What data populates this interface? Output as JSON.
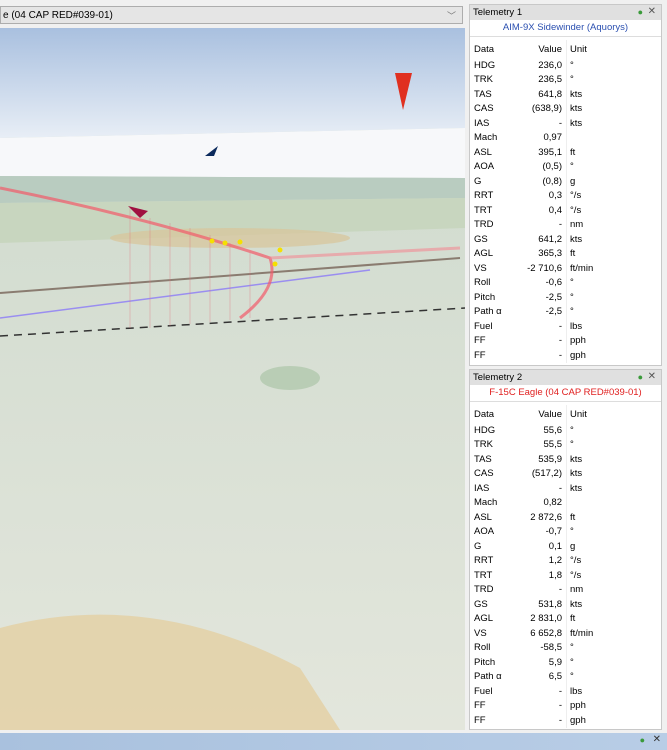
{
  "selector": {
    "value": "e (04 CAP RED#039-01)"
  },
  "panels": [
    {
      "title": "Telemetry 1",
      "subject": "AIM-9X Sidewinder (Aquorys)",
      "subject_color": "#2a4fb0",
      "headers": [
        "Data",
        "Value",
        "Unit"
      ],
      "rows": [
        [
          "HDG",
          "236,0",
          "°"
        ],
        [
          "TRK",
          "236,5",
          "°"
        ],
        [
          "TAS",
          "641,8",
          "kts"
        ],
        [
          "CAS",
          "(638,9)",
          "kts"
        ],
        [
          "IAS",
          "-",
          "kts"
        ],
        [
          "Mach",
          "0,97",
          ""
        ],
        [
          "ASL",
          "395,1",
          "ft"
        ],
        [
          "AOA",
          "(0,5)",
          "°"
        ],
        [
          "G",
          "(0,8)",
          "g"
        ],
        [
          "RRT",
          "0,3",
          "°/s"
        ],
        [
          "TRT",
          "0,4",
          "°/s"
        ],
        [
          "TRD",
          "-",
          "nm"
        ],
        [
          "GS",
          "641,2",
          "kts"
        ],
        [
          "AGL",
          "365,3",
          "ft"
        ],
        [
          "VS",
          "-2 710,6",
          "ft/min"
        ],
        [
          "Roll",
          "-0,6",
          "°"
        ],
        [
          "Pitch",
          "-2,5",
          "°"
        ],
        [
          "Path α",
          "-2,5",
          "°"
        ],
        [
          "Fuel",
          "-",
          "lbs"
        ],
        [
          "FF",
          "-",
          "pph"
        ],
        [
          "FF",
          "-",
          "gph"
        ]
      ]
    },
    {
      "title": "Telemetry 2",
      "subject": "F-15C Eagle (04 CAP RED#039-01)",
      "subject_color": "#e02020",
      "headers": [
        "Data",
        "Value",
        "Unit"
      ],
      "rows": [
        [
          "HDG",
          "55,6",
          "°"
        ],
        [
          "TRK",
          "55,5",
          "°"
        ],
        [
          "TAS",
          "535,9",
          "kts"
        ],
        [
          "CAS",
          "(517,2)",
          "kts"
        ],
        [
          "IAS",
          "-",
          "kts"
        ],
        [
          "Mach",
          "0,82",
          ""
        ],
        [
          "ASL",
          "2 872,6",
          "ft"
        ],
        [
          "AOA",
          "-0,7",
          "°"
        ],
        [
          "G",
          "0,1",
          "g"
        ],
        [
          "RRT",
          "1,2",
          "°/s"
        ],
        [
          "TRT",
          "1,8",
          "°/s"
        ],
        [
          "TRD",
          "-",
          "nm"
        ],
        [
          "GS",
          "531,8",
          "kts"
        ],
        [
          "AGL",
          "2 831,0",
          "ft"
        ],
        [
          "VS",
          "6 652,8",
          "ft/min"
        ],
        [
          "Roll",
          "-58,5",
          "°"
        ],
        [
          "Pitch",
          "5,9",
          "°"
        ],
        [
          "Path α",
          "6,5",
          "°"
        ],
        [
          "Fuel",
          "-",
          "lbs"
        ],
        [
          "FF",
          "-",
          "pph"
        ],
        [
          "FF",
          "-",
          "gph"
        ]
      ]
    }
  ]
}
